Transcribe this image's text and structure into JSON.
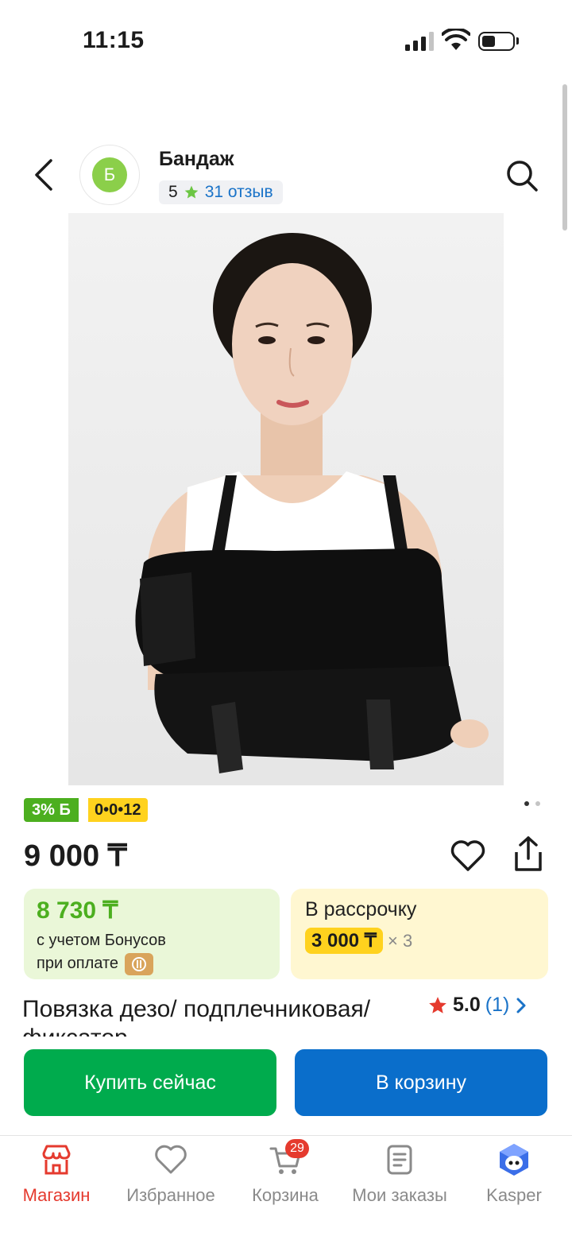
{
  "status_bar": {
    "time": "11:15"
  },
  "header": {
    "shop_logo_letter": "Б",
    "shop_name": "Бандаж",
    "shop_rating": "5",
    "shop_reviews": "31 отзыв"
  },
  "product_image": {
    "alt": "Бандаж"
  },
  "badges": {
    "bonus": "3% Б",
    "installment": "0•0•12"
  },
  "gallery": {
    "page_count": 2,
    "current_page": 1
  },
  "price": "9 000 ₸",
  "bonus_card": {
    "price": "8 730 ₸",
    "line1": "с учетом Бонусов",
    "line2": "при оплате"
  },
  "installment_card": {
    "title": "В рассрочку",
    "amount": "3 000 ₸",
    "multiplier": "× 3"
  },
  "product": {
    "title": "Повязка дезо/ подплечниковая/фиксатор",
    "rating": "5.0",
    "rating_count": "(1)"
  },
  "actions": {
    "buy_now": "Купить сейчас",
    "add_to_cart": "В корзину"
  },
  "tabbar": {
    "shop": "Магазин",
    "favorites": "Избранное",
    "cart": "Корзина",
    "cart_badge": "29",
    "orders": "Мои заказы",
    "kasper": "Kasper"
  },
  "colors": {
    "accent_red": "#e53a2e",
    "buy_green": "#00ab4d",
    "cart_blue": "#0a6ecb",
    "bonus_green": "#4caf1f",
    "installment_yellow": "#ffd21e"
  }
}
